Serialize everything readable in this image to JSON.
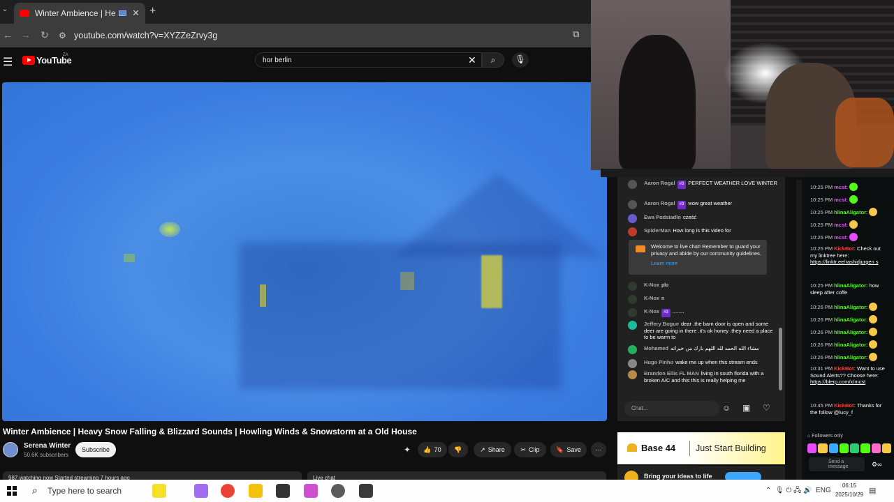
{
  "browser": {
    "tab_title": "Winter Ambience | Heavy Sno",
    "url": "youtube.com/watch?v=XYZZeZrvy3g",
    "icons": [
      "back-icon",
      "forward-icon",
      "reload-icon",
      "tune-icon",
      "cast-icon"
    ]
  },
  "youtube": {
    "logo_text": "YouTube",
    "region": "ZA",
    "search_value": "hor berlin",
    "video_title": "Winter Ambience | Heavy Snow Falling & Blizzard Sounds | Howling Winds & Snowstorm at a Old House",
    "channel_name": "Serena Winter",
    "subscribers": "50.6K subscribers",
    "subscribe_label": "Subscribe",
    "like_count": "70",
    "share_label": "Share",
    "clip_label": "Clip",
    "save_label": "Save",
    "watching_text": "987 watching now  Started streaming 7 hours ago",
    "live_chat_label": "Live chat"
  },
  "live_chat": {
    "messages": [
      {
        "name": "Aaron Rogal",
        "badge": "#3",
        "text": "PERFECT WEATHER LOVE WINTER",
        "avatar_color": "#555555"
      },
      {
        "name": "Aaron Rogal",
        "badge": "#3",
        "text": "wow great weather",
        "avatar_color": "#555555"
      },
      {
        "name": "Ewa Podsiadlo",
        "badge": "",
        "text": "cześć",
        "avatar_color": "#6a5acd"
      },
      {
        "name": "SpiderMan",
        "badge": "",
        "text": "How long is this video for",
        "avatar_color": "#c0392b"
      },
      {
        "name": "K-Nox",
        "badge": "",
        "text": "plo",
        "avatar_color": "#2e3b2e"
      },
      {
        "name": "K-Nox",
        "badge": "",
        "text": "n",
        "avatar_color": "#2e3b2e"
      },
      {
        "name": "K-Nox",
        "badge": "#3",
        "text": "........",
        "avatar_color": "#2e3b2e"
      },
      {
        "name": "Jeffery Bogue",
        "badge": "",
        "text": "dear .the barn door is open and some deer are going in there .it's ok honey .they need a place to be warm to",
        "avatar_color": "#1abc9c"
      },
      {
        "name": "Mohamed",
        "badge": "",
        "text": "مشاء الله الحمد لله اللهم بارك من خيراته",
        "avatar_color": "#27ae60"
      },
      {
        "name": "Hugo Pinho",
        "badge": "",
        "text": "wake me up when this stream ends",
        "avatar_color": "#888888"
      },
      {
        "name": "Brandon Ellis FL MAN",
        "badge": "",
        "text": "living in south florida with a broken A/C and this this is really helping me",
        "avatar_color": "#b58b4a"
      }
    ],
    "welcome_text": "Welcome to live chat! Remember to guard your privacy and abide by our community guidelines.",
    "learn_more": "Learn more",
    "chat_placeholder": "Chat..."
  },
  "ad": {
    "brand": "Base 44",
    "tagline": "Just Start Building",
    "line2": "Bring your ideas to life"
  },
  "kick_chat": {
    "messages": [
      {
        "time": "10:25 PM",
        "user": "mcst:",
        "user_color": "#e74cff",
        "text": "",
        "emote_color": "#53fc18"
      },
      {
        "time": "10:25 PM",
        "user": "mcst:",
        "user_color": "#e74cff",
        "text": "",
        "emote_color": "#53fc18"
      },
      {
        "time": "10:25 PM",
        "user": "hlinaAligator:",
        "user_color": "#53fc18",
        "text": "",
        "emote_color": "#f7c948"
      },
      {
        "time": "10:25 PM",
        "user": "mcst:",
        "user_color": "#e74cff",
        "text": "",
        "emote_color": "#f7c948"
      },
      {
        "time": "10:25 PM",
        "user": "mcst:",
        "user_color": "#e74cff",
        "text": "",
        "emote_color": "#e74cff"
      },
      {
        "time": "10:25 PM",
        "user": "KickBot:",
        "user_color": "#ff3b3b",
        "text": "Check out my linktree here: ",
        "link": "https://linktr.ee/rashidjurgen s",
        "emote_color": ""
      },
      {
        "time": "10:25 PM",
        "user": "hlinaAligator:",
        "user_color": "#53fc18",
        "text": "how sleep after coffe",
        "emote_color": ""
      },
      {
        "time": "10:26 PM",
        "user": "hlinaAligator:",
        "user_color": "#53fc18",
        "text": "",
        "emote_color": "#f7c948"
      },
      {
        "time": "10:26 PM",
        "user": "hlinaAligator:",
        "user_color": "#53fc18",
        "text": "",
        "emote_color": "#f7c948"
      },
      {
        "time": "10:26 PM",
        "user": "hlinaAligator:",
        "user_color": "#53fc18",
        "text": "",
        "emote_color": "#f7c948"
      },
      {
        "time": "10:26 PM",
        "user": "hlinaAligator:",
        "user_color": "#53fc18",
        "text": "",
        "emote_color": "#f7c948"
      },
      {
        "time": "10:26 PM",
        "user": "hlinaAligator:",
        "user_color": "#53fc18",
        "text": "",
        "emote_color": "#f7c948"
      },
      {
        "time": "10:31 PM",
        "user": "KickBot:",
        "user_color": "#ff3b3b",
        "text": "Want to use Sound Alerts?? Choose here: ",
        "link": "https://blerp.com/x/mcst",
        "emote_color": ""
      },
      {
        "time": "10:45 PM",
        "user": "KickBot:",
        "user_color": "#ff3b3b",
        "text": "Thanks for the follow @lucy_f",
        "emote_color": ""
      }
    ],
    "followers_only": "Followers only",
    "send_label": "Send a message"
  },
  "taskbar": {
    "search_placeholder": "Type here to search",
    "language": "ENG",
    "time": "06:15",
    "date": "2025/10/29",
    "app_colors": [
      "#f7e02b",
      "#a46cf0",
      "#ea4335",
      "#f4c20d",
      "#333333",
      "#d04fd0",
      "#5a5a5a",
      "#3a3a3a"
    ]
  }
}
